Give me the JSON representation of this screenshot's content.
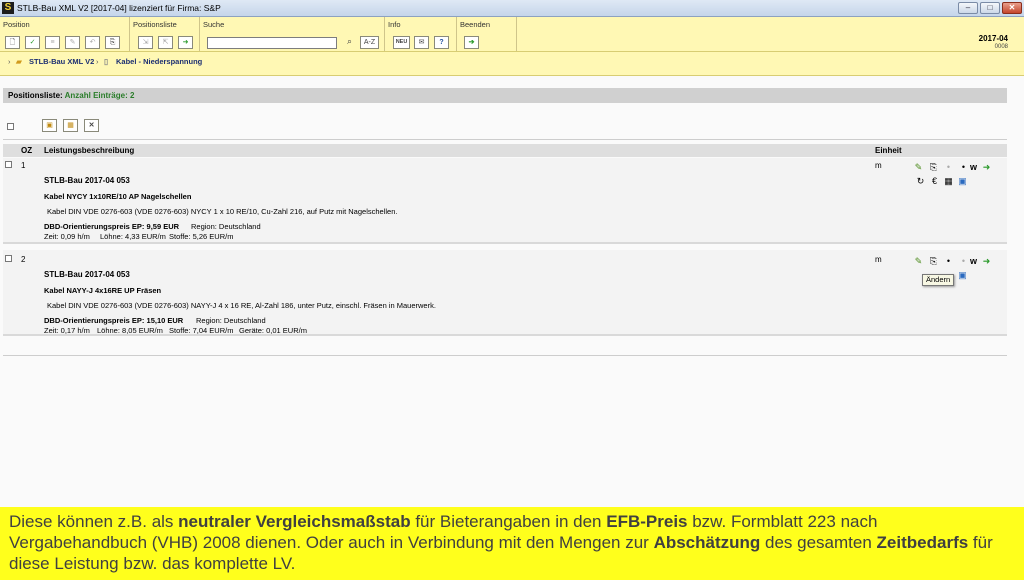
{
  "window": {
    "logo": "S",
    "title": "STLB-Bau XML V2 [2017-04] lizenziert für Firma: S&P"
  },
  "ribbon": {
    "groups": [
      "Position",
      "Positionsliste",
      "Suche",
      "Info",
      "Beenden"
    ],
    "search_value": "",
    "search_btn_label": "A-Z",
    "info_new_label": "NEU",
    "version_year": "2017-04",
    "version_number": "0008"
  },
  "breadcrumb": {
    "root": "STLB-Bau XML V2",
    "leaf": "Kabel - Niederspannung"
  },
  "list": {
    "header_label": "Positionsliste:",
    "header_count": "Anzahl Einträge: 2",
    "columns": {
      "oz": "OZ",
      "desc": "Leistungsbeschreibung",
      "unit": "Einheit"
    },
    "rows": [
      {
        "oz": "1",
        "source": "STLB-Bau 2017-04 053",
        "short": "Kabel NYCY 1x10RE/10 AP Nagelschellen",
        "long": "Kabel DIN VDE 0276-603 (VDE 0276-603) NYCY 1 x 10 RE/10, Cu-Zahl 216, auf Putz mit Nagelschellen.",
        "price": "DBD-Orientierungspreis EP: 9,59 EUR",
        "region": "Region: Deutschland",
        "time": "Zeit: 0,09 h/m",
        "wages": "Löhne: 4,33 EUR/m",
        "materials": "Stoffe: 5,26 EUR/m",
        "devices": "",
        "unit": "m"
      },
      {
        "oz": "2",
        "source": "STLB-Bau 2017-04 053",
        "short": "Kabel NAYY-J 4x16RE UP Fräsen",
        "long": "Kabel DIN VDE 0276-603 (VDE 0276-603) NAYY-J 4 x 16 RE, Al-Zahl 186, unter Putz, einschl. Fräsen in Mauerwerk.",
        "price": "DBD-Orientierungspreis EP: 15,10 EUR",
        "region": "Region: Deutschland",
        "time": "Zeit: 0,17 h/m",
        "wages": "Löhne: 8,05 EUR/m",
        "materials": "Stoffe: 7,04 EUR/m",
        "devices": "Geräte: 0,01 EUR/m",
        "unit": "m"
      }
    ],
    "action_w": "w",
    "tooltip": "Ändern"
  },
  "footer": {
    "p1": "Diese können z.B. als ",
    "b1": "neutraler Vergleichsmaßstab",
    "p2": " für Bieterangaben in den ",
    "b2": "EFB-Preis",
    "p3": " bzw. Formblatt 223 nach Vergabehandbuch (VHB) 2008 dienen. Oder auch in Verbindung mit den Mengen zur ",
    "b3": "Abschätzung",
    "p4": " des gesamten ",
    "b4": "Zeitbedarfs",
    "p5": " für diese Leistung bzw. das komplette LV."
  },
  "colors": {
    "ribbon_bg": "#fff8b4",
    "footer_bg": "#ffff1c",
    "count_green": "#2a7d2a",
    "link_blue": "#1c2f72"
  }
}
